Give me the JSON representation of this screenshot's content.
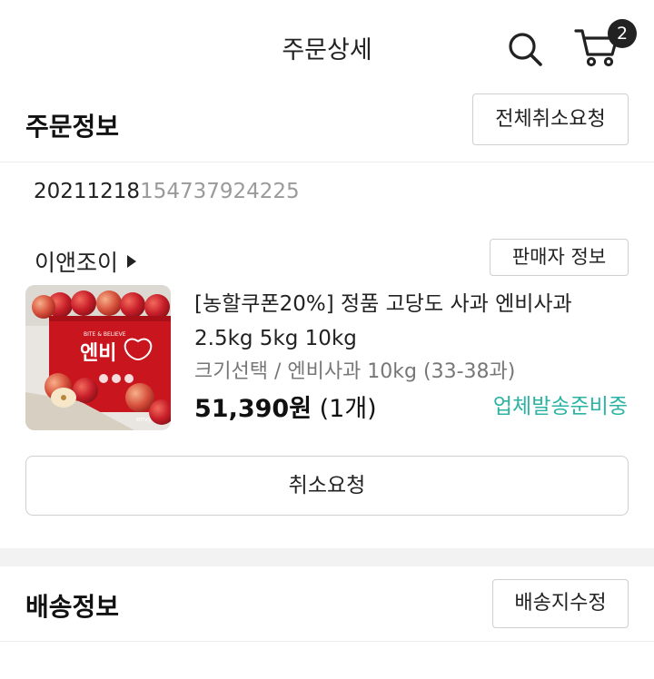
{
  "header": {
    "title": "주문상세",
    "cart_count": "2",
    "search_icon": "search-icon",
    "cart_icon": "cart-icon"
  },
  "order_info": {
    "title": "주문정보",
    "cancel_all_label": "전체취소요청",
    "order_number_prefix": "20211218",
    "order_number_suffix": "154737924225"
  },
  "seller": {
    "name": "이앤조이",
    "info_button": "판매자 정보"
  },
  "product": {
    "name": "[농할쿠폰20%] 정품 고당도 사과 엔비사과 2.5kg 5kg 10kg",
    "option": "크기선택 / 엔비사과 10kg (33-38과)",
    "price": "51,390원",
    "quantity": "(1개)",
    "status": "업체발송준비중",
    "status_color": "#2bb3a3",
    "image_box_text": "BITE & BELIEVE",
    "image_brand": "엔비",
    "image_logo": "envy"
  },
  "cancel_request_label": "취소요청",
  "delivery": {
    "title": "배송정보",
    "edit_label": "배송지수정"
  }
}
